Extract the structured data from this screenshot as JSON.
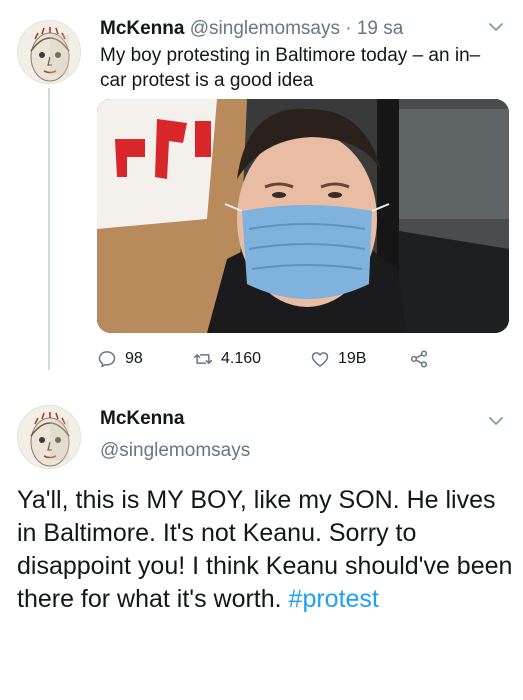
{
  "tweet1": {
    "name": "McKenna",
    "handle": "@singlemomsays",
    "separator": "·",
    "time": "19 sa",
    "text": "My boy protesting in Baltimore today – an in–car protest is a good idea",
    "actions": {
      "reply_count": "98",
      "retweet_count": "4.160",
      "like_count": "19B"
    }
  },
  "tweet2": {
    "name": "McKenna",
    "handle": "@singlemomsays",
    "text_main": "Ya'll, this is MY BOY, like my SON. He lives in Baltimore.  It's not Keanu. Sorry to disappoint you!  I think Keanu should've been there for what it's worth. ",
    "hashtag": "#protest"
  },
  "colors": {
    "hashtag": "#1da1f2",
    "secondary_text": "#657786",
    "thread_line": "#cfd9de"
  }
}
